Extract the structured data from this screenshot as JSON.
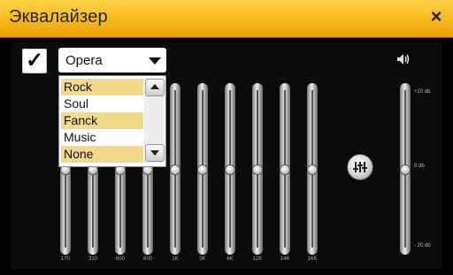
{
  "window": {
    "title": "Эквалайзер",
    "close_glyph": "×"
  },
  "controls": {
    "enabled_checked": true,
    "check_glyph": "✓",
    "preset_selected": "Opera",
    "preset_options": [
      "Rock",
      "Soul",
      "Fanck",
      "Music",
      "None"
    ],
    "preset_highlighted": [
      "Rock",
      "Fanck",
      "None"
    ]
  },
  "equalizer": {
    "bands": [
      {
        "label": "170",
        "level": 0
      },
      {
        "label": "310",
        "level": 0
      },
      {
        "label": "600",
        "level": 0
      },
      {
        "label": "600",
        "level": 0
      },
      {
        "label": "1K",
        "level": 0
      },
      {
        "label": "3K",
        "level": 0
      },
      {
        "label": "6K",
        "level": 0
      },
      {
        "label": "12K",
        "level": 0
      },
      {
        "label": "14K",
        "level": 0
      },
      {
        "label": "16K",
        "level": 0
      }
    ]
  },
  "volume": {
    "icon": "speaker-icon",
    "max_label": "+20 db",
    "mid_label": "0 db",
    "min_label": "- 20 db",
    "level": 0
  },
  "preset_button": {
    "icon": "sliders-icon"
  },
  "colors": {
    "titlebar": "#f7b818",
    "background": "#000000",
    "highlight": "#f3d98a"
  }
}
